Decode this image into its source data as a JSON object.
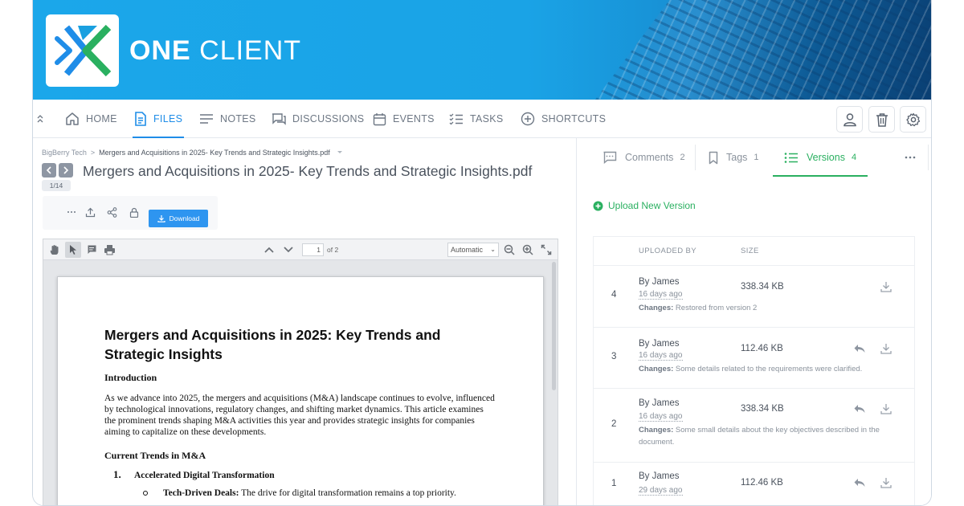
{
  "brand": {
    "name_bold": "ONE",
    "name_rest": " CLIENT"
  },
  "nav": {
    "items": [
      {
        "label": "HOME",
        "icon": "home-icon"
      },
      {
        "label": "FILES",
        "icon": "file-icon",
        "active": true
      },
      {
        "label": "NOTES",
        "icon": "notes-icon"
      },
      {
        "label": "DISCUSSIONS",
        "icon": "chat-icon"
      },
      {
        "label": "EVENTS",
        "icon": "calendar-icon"
      },
      {
        "label": "TASKS",
        "icon": "checklist-icon"
      },
      {
        "label": "SHORTCUTS",
        "icon": "plus-circle-icon"
      }
    ],
    "right_icons": [
      "user-icon",
      "trash-icon",
      "gear-icon"
    ]
  },
  "file": {
    "breadcrumb": {
      "root": "BigBerry Tech",
      "current": "Mergers and Acquisitions in 2025- Key Trends and Strategic Insights.pdf"
    },
    "title": "Mergers and Acquisitions in 2025- Key Trends and Strategic Insights.pdf",
    "page_indicator": "1/14",
    "toolbar": {
      "download_label": "Download"
    }
  },
  "viewer": {
    "page_value": "1",
    "page_of": "of 2",
    "zoom": "Automatic"
  },
  "document": {
    "heading": "Mergers and Acquisitions in 2025: Key Trends and Strategic Insights",
    "intro_heading": "Introduction",
    "intro_body": "As we advance into 2025, the mergers and acquisitions (M&A) landscape continues to evolve, influenced by technological innovations, regulatory changes, and shifting market dynamics. This article examines the prominent trends shaping M&A activities this year and provides strategic insights for companies aiming to capitalize on these developments.",
    "trends_heading": "Current Trends in M&A",
    "item_number": "1.",
    "item_title": "Accelerated Digital Transformation",
    "bullet_bold": "Tech-Driven Deals:",
    "bullet_text": " The drive for digital transformation remains a top priority."
  },
  "side_tabs": {
    "comments": {
      "label": "Comments",
      "count": "2"
    },
    "tags": {
      "label": "Tags",
      "count": "1"
    },
    "versions": {
      "label": "Versions",
      "count": "4"
    }
  },
  "versions": {
    "upload_label": "Upload New Version",
    "col_uploaded_by": "UPLOADED BY",
    "col_size": "SIZE",
    "changes_prefix": "Changes:",
    "rows": [
      {
        "number": "4",
        "by": "By James",
        "date": "16 days ago",
        "size": "338.34 KB",
        "changes": " Restored from version 2"
      },
      {
        "number": "3",
        "by": "By James",
        "date": "16 days ago",
        "size": "112.46 KB",
        "changes": " Some details related to the requirements were clarified."
      },
      {
        "number": "2",
        "by": "By James",
        "date": "16 days ago",
        "size": "338.34 KB",
        "changes": " Some small details about the key objectives described in the document."
      },
      {
        "number": "1",
        "by": "By James",
        "date": "29 days ago",
        "size": "112.46 KB",
        "changes": ""
      }
    ]
  },
  "colors": {
    "accent_blue": "#1f8de8",
    "accent_green": "#2ab060",
    "banner": "#1ba7ea"
  }
}
